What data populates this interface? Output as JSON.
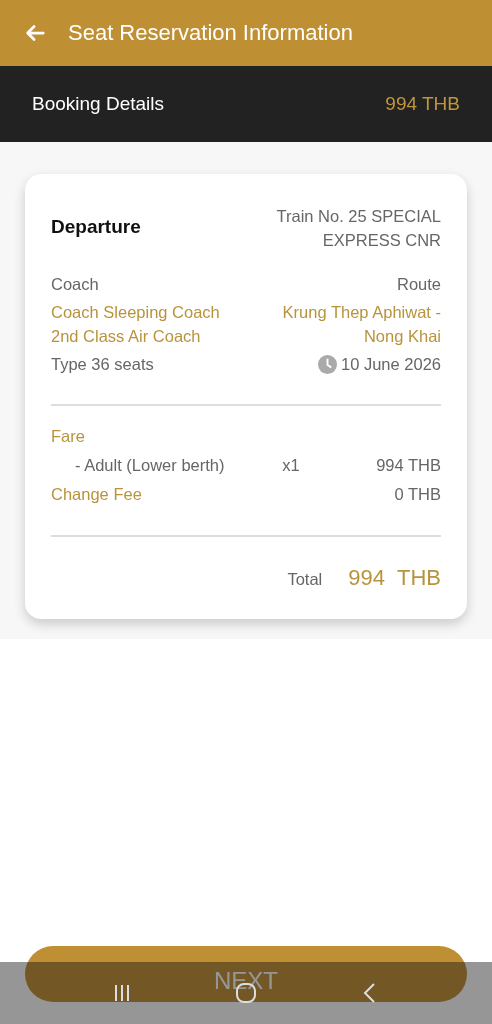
{
  "app_bar": {
    "title": "Seat Reservation Information"
  },
  "summary": {
    "label": "Booking Details",
    "amount": "994 THB"
  },
  "card": {
    "title": "Departure",
    "train": "Train No. 25 SPECIAL EXPRESS CNR",
    "coach_label": "Coach",
    "route_label": "Route",
    "coach": "Coach Sleeping Coach 2nd Class Air Coach",
    "route": "Krung Thep Aphiwat - Nong Khai",
    "type": "Type 36 seats",
    "date": "10 June 2026",
    "fare_lines": [
      {
        "kind": "heading",
        "label": "Fare"
      },
      {
        "kind": "item",
        "label": "- Adult (Lower berth)",
        "qty": "x1",
        "amount": "994 THB"
      },
      {
        "kind": "fee",
        "label": "Change Fee",
        "amount": "0 THB"
      }
    ],
    "total": {
      "label": "Total",
      "amount": "994",
      "currency": "THB"
    }
  },
  "next_button": "NEXT"
}
